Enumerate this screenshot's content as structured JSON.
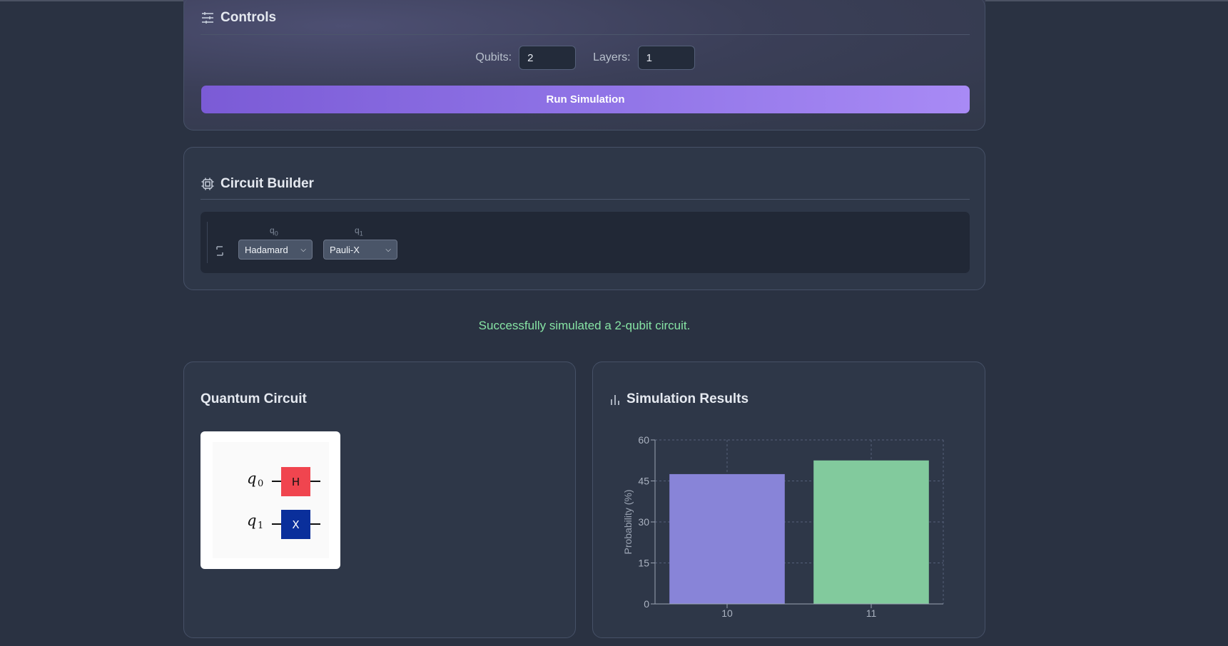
{
  "controls": {
    "title": "Controls",
    "qubits_label": "Qubits:",
    "qubits_value": "2",
    "layers_label": "Layers:",
    "layers_value": "1",
    "run_label": "Run Simulation"
  },
  "builder": {
    "title": "Circuit Builder",
    "qubits": [
      {
        "label": "q",
        "sub": "0",
        "gate": "Hadamard"
      },
      {
        "label": "q",
        "sub": "1",
        "gate": "Pauli-X"
      }
    ]
  },
  "status": "Successfully simulated a 2-qubit circuit.",
  "circuit": {
    "title": "Quantum Circuit",
    "wires": [
      {
        "label": "q",
        "sub": "0",
        "gate": "H",
        "color": "#f0454f"
      },
      {
        "label": "q",
        "sub": "1",
        "gate": "X",
        "color": "#0a2f9b"
      }
    ]
  },
  "results": {
    "title": "Simulation Results"
  },
  "chart_data": {
    "type": "bar",
    "categories": [
      "10",
      "11"
    ],
    "values": [
      47.5,
      52.5
    ],
    "colors": [
      "#8884d8",
      "#82ca9d"
    ],
    "ylabel": "Probability (%)",
    "ylim": [
      0,
      60
    ],
    "yticks": [
      0,
      15,
      30,
      45,
      60
    ],
    "grid": true
  }
}
